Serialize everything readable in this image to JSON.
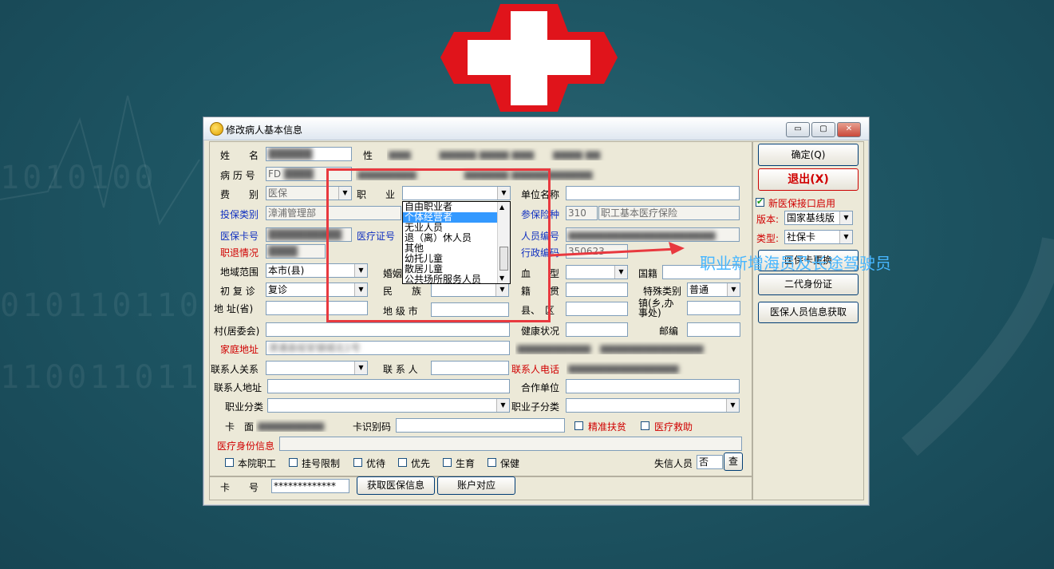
{
  "window": {
    "title": "修改病人基本信息",
    "controls": [
      "▭",
      "▢",
      "✕"
    ]
  },
  "form": {
    "name_label": "姓　　名",
    "sex_label": "性",
    "record_no_label": "病 历 号",
    "record_no_value": "FD",
    "fee_label": "费　　别",
    "fee_value": "医保",
    "occupation_label": "职　　业",
    "occupation_value": "",
    "unit_name_label": "单位名称",
    "insure_type_label": "投保类别",
    "insure_type_value": "漳浦管理部",
    "insurance_kind_label": "参保险种",
    "insurance_kind_code": "310",
    "insurance_kind_value": "职工基本医疗保险",
    "med_card_label": "医保卡号",
    "med_cert_label": "医疗证号",
    "person_no_label": "人员编号",
    "retire_label": "职退情况",
    "admin_code_label": "行政编码",
    "admin_code_value": "350623",
    "region_label": "地域范围",
    "region_value": "本市(县)",
    "marriage_label": "婚姻",
    "blood_label": "血　　型",
    "nationality_label": "国籍",
    "visit_label": "初 复 诊",
    "visit_value": "复诊",
    "ethnic_label": "民　　族",
    "native_label": "籍　　贯",
    "special_label": "特殊类别",
    "special_value": "普通",
    "addr_prov_label": "地 址(省)",
    "prefecture_label": "地 级 市",
    "county_label": "县、　区",
    "town_label": "镇(乡,办事处)",
    "village_label": "村(居委会)",
    "health_label": "健康状况",
    "postcode_label": "邮编",
    "home_addr_label": "家庭地址",
    "home_addr_value": "漳浦县绥安镇城北1号",
    "contact_rel_label": "联系人关系",
    "contact_label": "联 系 人",
    "contact_phone_label": "联系人电话",
    "contact_addr_label": "联系人地址",
    "coop_unit_label": "合作单位",
    "occ_class_label": "职业分类",
    "occ_subclass_label": "职业子分类",
    "card_face_label": "卡　面",
    "card_id_label": "卡识别码",
    "poverty_label": "精准扶贫",
    "relief_label": "医疗救助",
    "med_identity_label": "医疗身份信息",
    "checks": [
      "本院职工",
      "挂号限制",
      "优待",
      "优先",
      "生育",
      "保健"
    ],
    "dishonest_label": "失信人员",
    "dishonest_value": "否",
    "check_button": "查",
    "card_no_label": "卡　　号",
    "card_no_value": "*************",
    "get_insurance_button": "获取医保信息",
    "account_button": "账户对应"
  },
  "occupation_list": {
    "items": [
      "自由职业者",
      "个体经营者",
      "无业人员",
      "退（离）休人员",
      "其他",
      "幼托儿童",
      "散居儿童",
      "公共场所服务人员"
    ],
    "selected": "个体经营者"
  },
  "right_panel": {
    "ok_button": "确定(Q)",
    "exit_button": "退出(X)",
    "new_interface_label": "新医保接口启用",
    "new_interface_checked": true,
    "version_label": "版本:",
    "version_value": "国家基线版",
    "type_label": "类型:",
    "type_value": "社保卡",
    "medcard_change_button": "医保卡更换",
    "id2_button": "二代身份证",
    "fetch_button": "医保人员信息获取"
  },
  "annotation": "职业新增海员及长途驾驶员",
  "colors": {
    "highlight": "#e8393f",
    "annotation": "#47b6ff",
    "selection": "#3399ff"
  }
}
